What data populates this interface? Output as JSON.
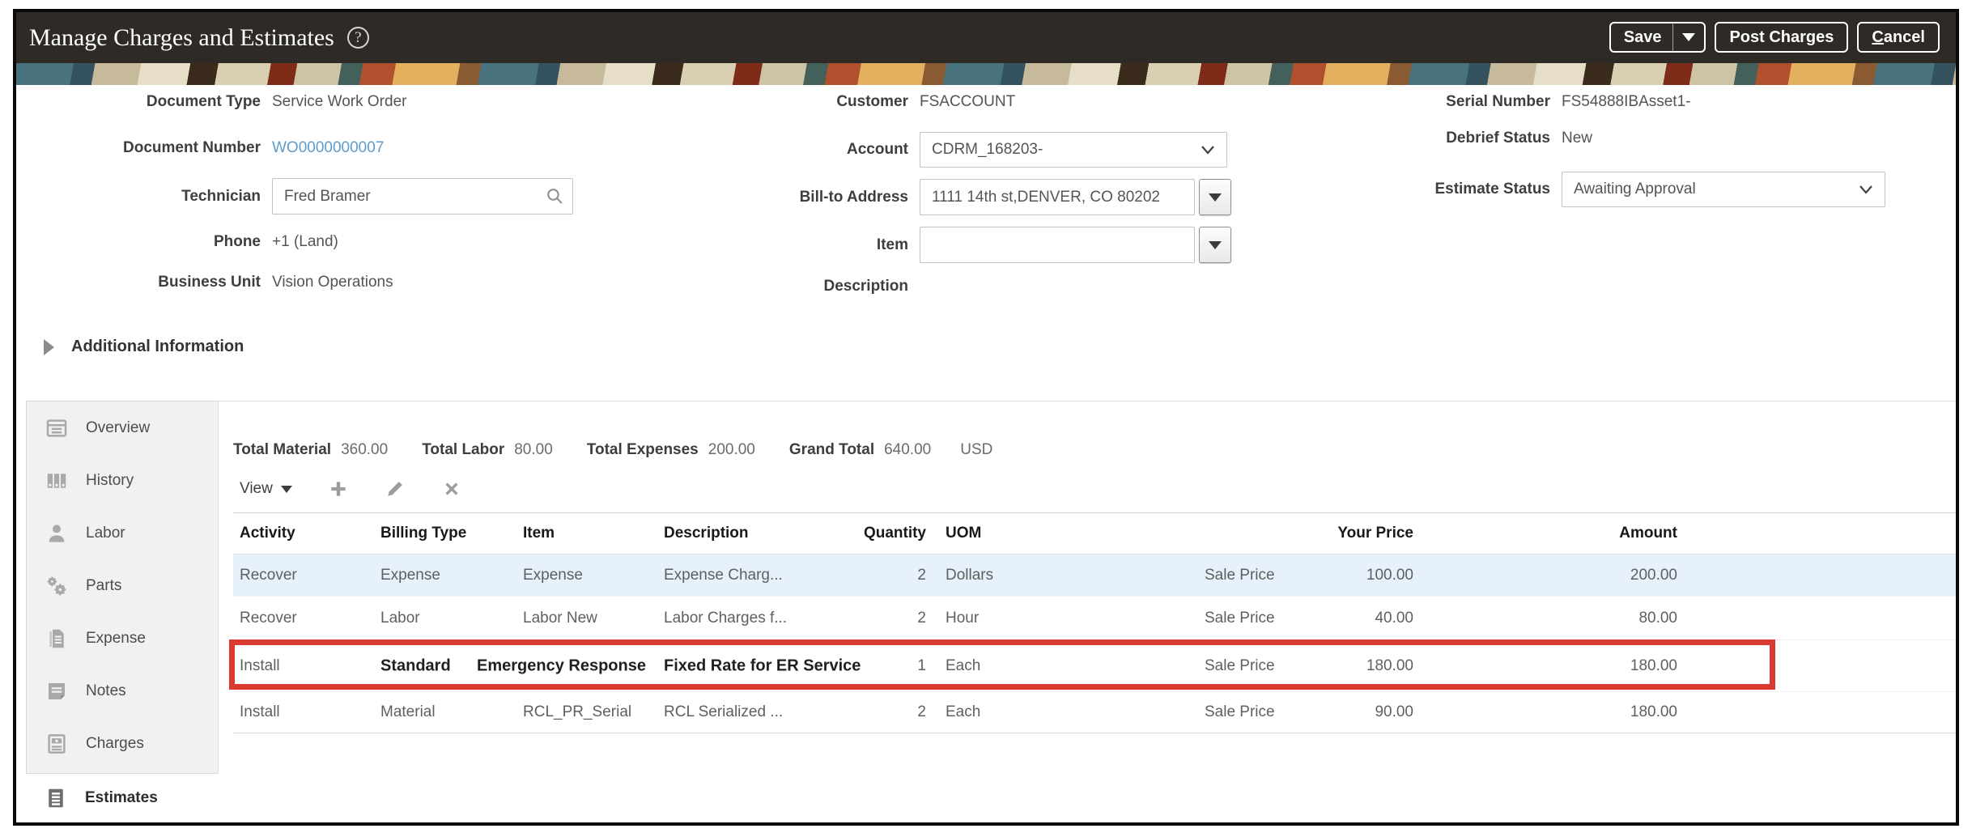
{
  "header": {
    "title": "Manage Charges and Estimates",
    "help_glyph": "?",
    "buttons": {
      "save": "Save",
      "post_charges": "Post Charges",
      "cancel_first_letter": "C",
      "cancel_rest": "ancel"
    }
  },
  "form": {
    "document_type": {
      "label": "Document Type",
      "value": "Service Work Order"
    },
    "document_number": {
      "label": "Document Number",
      "value": "WO0000000007"
    },
    "technician": {
      "label": "Technician",
      "value": "Fred Bramer"
    },
    "phone": {
      "label": "Phone",
      "value": "+1 (Land)"
    },
    "business_unit": {
      "label": "Business Unit",
      "value": "Vision Operations"
    },
    "customer": {
      "label": "Customer",
      "value": "FSACCOUNT"
    },
    "account": {
      "label": "Account",
      "value": "CDRM_168203-"
    },
    "bill_to_address": {
      "label": "Bill-to Address",
      "value": "1111 14th st,DENVER, CO 80202"
    },
    "item": {
      "label": "Item",
      "value": ""
    },
    "description": {
      "label": "Description",
      "value": ""
    },
    "serial_number": {
      "label": "Serial Number",
      "value": "FS54888IBAsset1-"
    },
    "debrief_status": {
      "label": "Debrief Status",
      "value": "New"
    },
    "estimate_status": {
      "label": "Estimate Status",
      "value": "Awaiting Approval"
    }
  },
  "additional_information": {
    "label": "Additional Information"
  },
  "sidebar": {
    "items": [
      {
        "label": "Overview"
      },
      {
        "label": "History"
      },
      {
        "label": "Labor"
      },
      {
        "label": "Parts"
      },
      {
        "label": "Expense"
      },
      {
        "label": "Notes"
      },
      {
        "label": "Charges"
      },
      {
        "label": "Estimates"
      }
    ],
    "selected": "Estimates"
  },
  "totals": {
    "total_material_label": "Total Material",
    "total_material": "360.00",
    "total_labor_label": "Total Labor",
    "total_labor": "80.00",
    "total_expenses_label": "Total Expenses",
    "total_expenses": "200.00",
    "grand_total_label": "Grand Total",
    "grand_total": "640.00",
    "currency": "USD"
  },
  "toolbar": {
    "view_label": "View"
  },
  "table": {
    "columns": {
      "activity": "Activity",
      "billing_type": "Billing Type",
      "item": "Item",
      "description": "Description",
      "quantity": "Quantity",
      "uom": "UOM",
      "your_price": "Your Price",
      "amount": "Amount"
    },
    "rows": [
      {
        "activity": "Recover",
        "billing_type": "Expense",
        "item": "Expense",
        "description": "Expense Charg...",
        "quantity": "2",
        "uom": "Dollars",
        "price_type": "Sale Price",
        "your_price": "100.00",
        "amount": "200.00"
      },
      {
        "activity": "Recover",
        "billing_type": "Labor",
        "item": "Labor New",
        "description": "Labor Charges f...",
        "quantity": "2",
        "uom": "Hour",
        "price_type": "Sale Price",
        "your_price": "40.00",
        "amount": "80.00"
      },
      {
        "activity": "Install",
        "billing_type": "Standard",
        "item": "Emergency Response",
        "description": "Fixed Rate for ER Service",
        "quantity": "1",
        "uom": "Each",
        "price_type": "Sale Price",
        "your_price": "180.00",
        "amount": "180.00"
      },
      {
        "activity": "Install",
        "billing_type": "Material",
        "item": "RCL_PR_Serial",
        "description": "RCL Serialized ...",
        "quantity": "2",
        "uom": "Each",
        "price_type": "Sale Price",
        "your_price": "90.00",
        "amount": "180.00"
      }
    ]
  },
  "colors": {
    "annotation_red": "#d93a31",
    "selected_row_blue": "#e7f1fb",
    "header_brown": "#2e2a26"
  }
}
